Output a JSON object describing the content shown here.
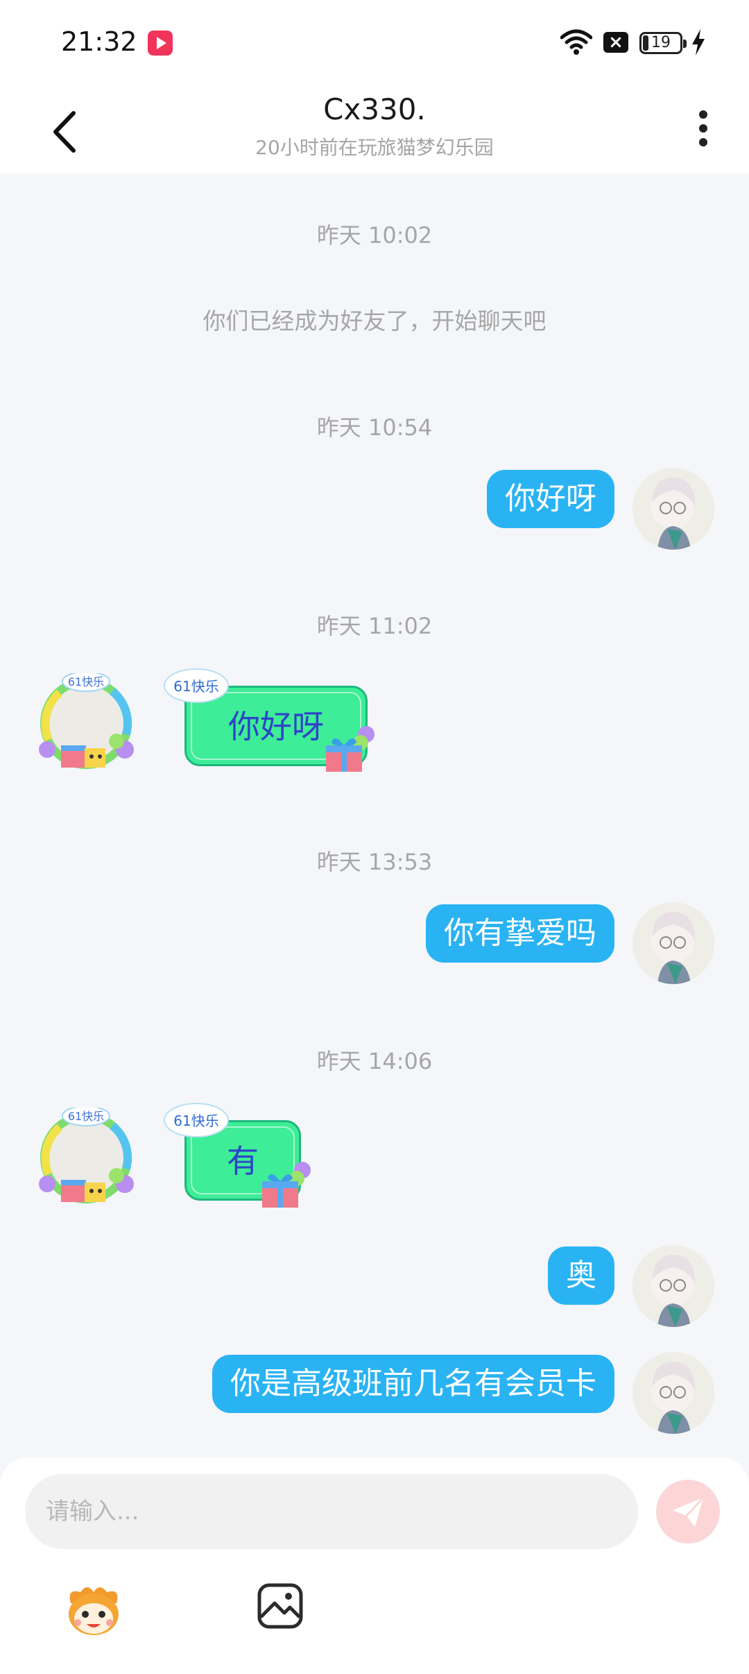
{
  "status_bar": {
    "time": "21:32",
    "battery": "19"
  },
  "header": {
    "title": "Cx330.",
    "subtitle": "20小时前在玩旅猫梦幻乐园"
  },
  "messages": {
    "ts1": "昨天 10:02",
    "system": "你们已经成为好友了，开始聊天吧",
    "ts2": "昨天 10:54",
    "m1": "你好呀",
    "ts3": "昨天 11:02",
    "sticker1": "你好呀",
    "ts4": "昨天 13:53",
    "m2": "你有挚爱吗",
    "ts5": "昨天 14:06",
    "sticker2": "有",
    "m3": "奥",
    "m4": "你是高级班前几名有会员卡"
  },
  "sticker_tag": "61快乐",
  "composer": {
    "placeholder": "请输入..."
  },
  "icons": [
    "back-icon",
    "more-icon",
    "emoji-icon",
    "image-icon",
    "send-icon",
    "wifi-icon",
    "battery-icon",
    "charging-icon"
  ],
  "colors": {
    "bubble_out": "#2ab3f3",
    "sticker_bg": "#3ded97",
    "send_bg": "#fcd6d6"
  }
}
